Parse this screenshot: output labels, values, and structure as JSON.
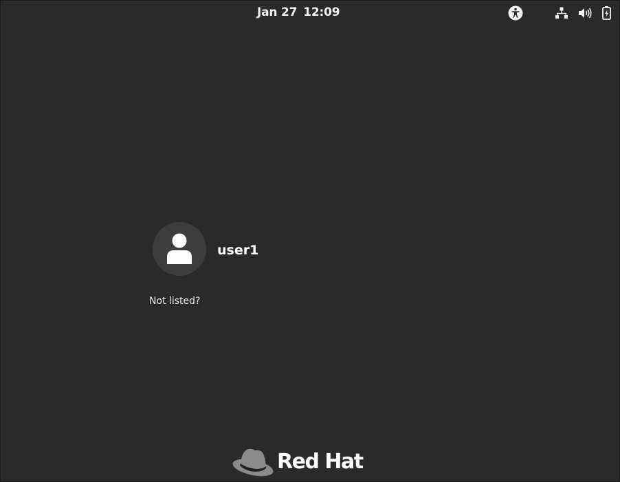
{
  "topbar": {
    "date": "Jan 27",
    "time": "12:09",
    "icons": [
      "accessibility-icon",
      "network-icon",
      "volume-icon",
      "battery-icon"
    ]
  },
  "user_list": {
    "users": [
      {
        "name": "user1",
        "avatar_icon": "user-avatar-icon"
      }
    ],
    "not_listed_label": "Not listed?"
  },
  "branding": {
    "logo_text": "Red Hat",
    "logo_icon": "red-hat-logo-icon"
  },
  "colors": {
    "background": "#2a2a2a",
    "avatar_bg": "#3d3d3d",
    "text": "#ffffff",
    "logo_hat": "#8a8a8a"
  }
}
